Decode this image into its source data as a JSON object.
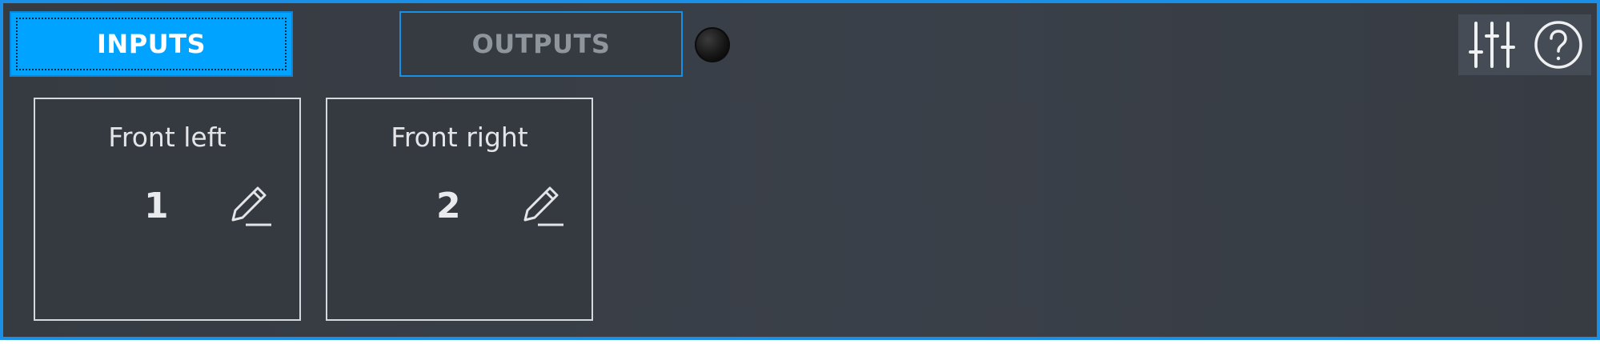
{
  "tabs": {
    "inputs_label": "INPUTS",
    "outputs_label": "OUTPUTS"
  },
  "toolbar": {
    "mixer_icon": "sliders-icon",
    "help_icon": "help-icon"
  },
  "channels": [
    {
      "name": "Front left",
      "number": "1"
    },
    {
      "name": "Front right",
      "number": "2"
    }
  ],
  "colors": {
    "accent": "#00a3ff",
    "border": "#1b8fe6",
    "background": "#373c43"
  }
}
